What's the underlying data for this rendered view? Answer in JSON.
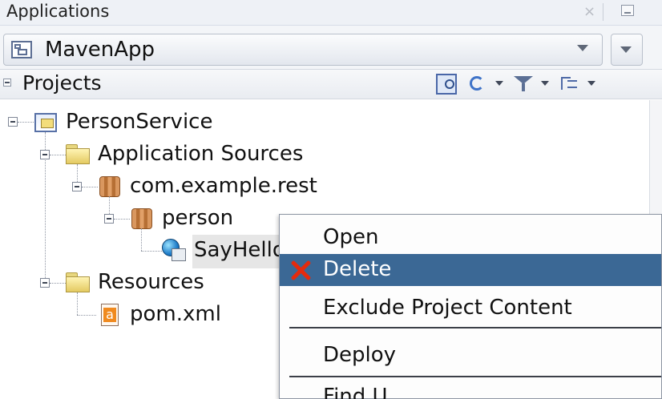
{
  "header": {
    "title": "Applications",
    "close_glyph": "×"
  },
  "selector": {
    "selected_app": "MavenApp"
  },
  "projects": {
    "label": "Projects"
  },
  "tree": {
    "project": "PersonService",
    "application_sources": "Application Sources",
    "package": "com.example.rest",
    "subpackage": "person",
    "selected_item": "SayHello",
    "resources": "Resources",
    "pom": "pom.xml"
  },
  "context_menu": {
    "open": "Open",
    "delete": "Delete",
    "exclude": "Exclude Project Content",
    "deploy": "Deploy",
    "partial": "Find U"
  },
  "icons": {
    "xml_badge": "a"
  }
}
